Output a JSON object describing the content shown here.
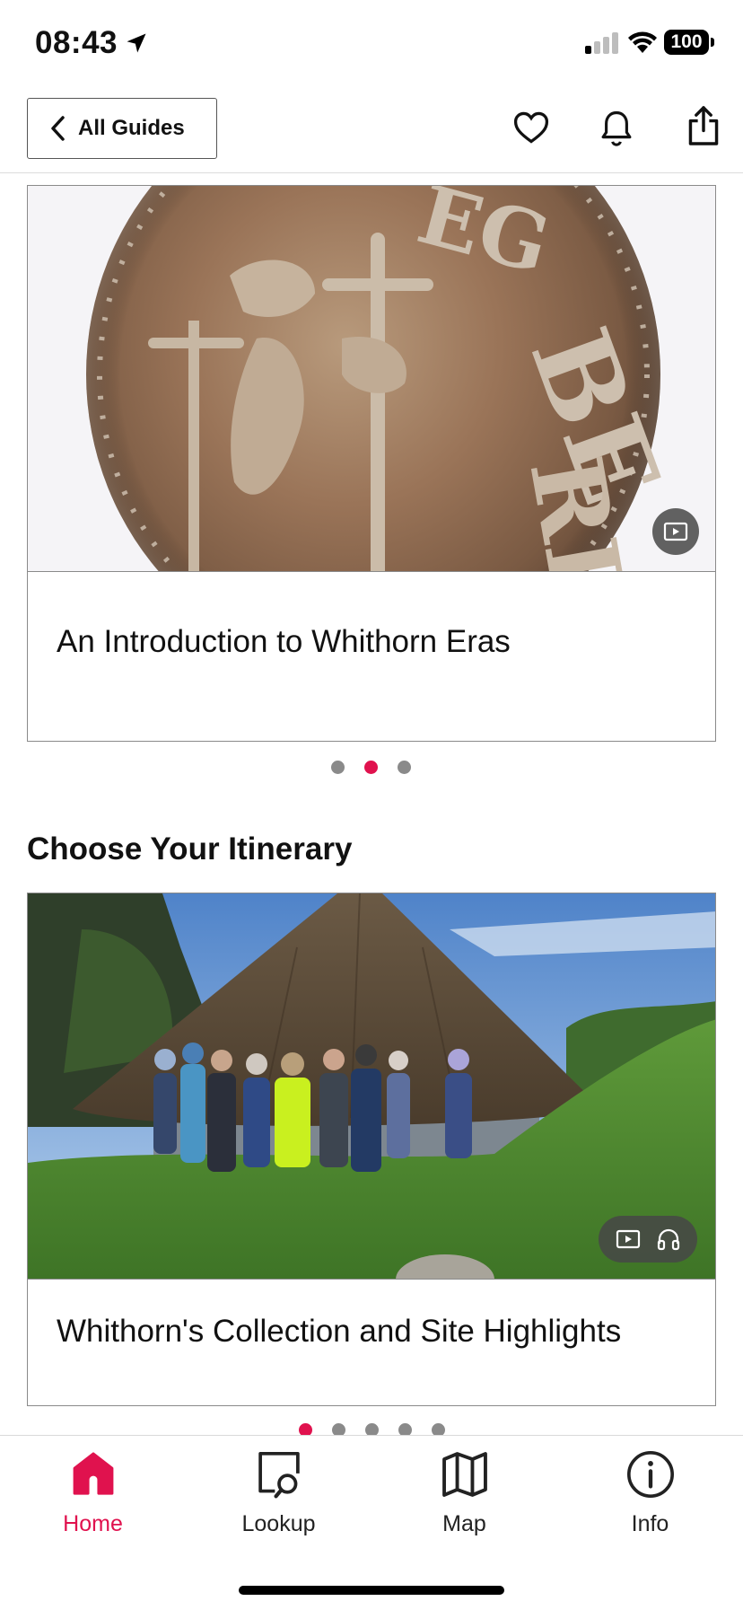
{
  "status_bar": {
    "time": "08:43",
    "battery": "100",
    "icons": [
      "location-arrow-icon",
      "cellular-signal-icon",
      "wifi-icon",
      "battery-icon"
    ]
  },
  "header": {
    "back_label": "All Guides",
    "icons": [
      "heart-icon",
      "bell-icon",
      "share-icon"
    ]
  },
  "featured": {
    "title": "An Introduction to Whithorn Eras",
    "media": [
      "video-icon"
    ],
    "pager": {
      "count": 3,
      "active": 1
    }
  },
  "itinerary": {
    "heading": "Choose Your Itinerary",
    "title": "Whithorn's Collection and Site Highlights",
    "media": [
      "video-icon",
      "headphones-icon"
    ],
    "pager": {
      "count": 5,
      "active": 0
    }
  },
  "tabs": [
    {
      "label": "Home",
      "icon": "home-icon",
      "active": true
    },
    {
      "label": "Lookup",
      "icon": "lookup-icon",
      "active": false
    },
    {
      "label": "Map",
      "icon": "map-icon",
      "active": false
    },
    {
      "label": "Info",
      "icon": "info-icon",
      "active": false
    }
  ],
  "colors": {
    "accent": "#e0124e",
    "dot_inactive": "#8a8a8a",
    "border": "#8a8a8a"
  }
}
